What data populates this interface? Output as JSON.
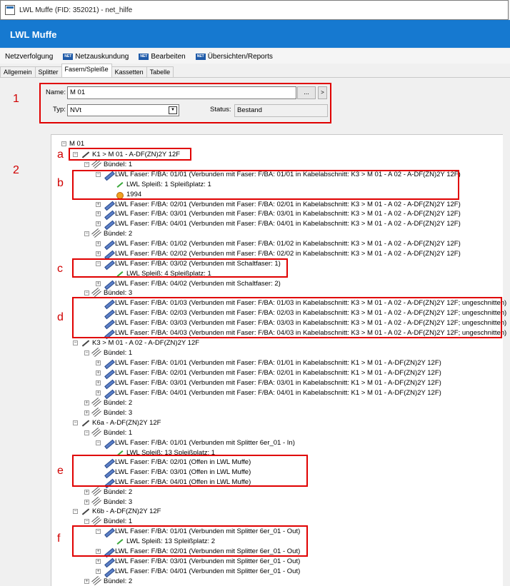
{
  "window": {
    "title": "LWL Muffe (FID: 352021) - net_hilfe"
  },
  "banner": {
    "title": "LWL Muffe"
  },
  "menu": [
    {
      "label": "Netzverfolgung",
      "icon": ""
    },
    {
      "label": "Netzauskundung",
      "icon": "NET"
    },
    {
      "label": "Bearbeiten",
      "icon": "NET"
    },
    {
      "label": "Übersichten/Reports",
      "icon": "NET"
    }
  ],
  "tabs": [
    "Allgemein",
    "Splitter",
    "Fasern/Spleiße",
    "Kassetten",
    "Tabelle"
  ],
  "form": {
    "name_label": "Name:",
    "name_value": "M 01",
    "dots_label": "...",
    "arrow_label": ">",
    "typ_label": "Typ:",
    "typ_value": "NVt",
    "status_label": "Status:",
    "status_value": "Bestand"
  },
  "markers": {
    "m1": "1",
    "m2": "2",
    "a": "a",
    "b": "b",
    "c": "c",
    "d": "d",
    "e": "e",
    "f": "f"
  },
  "tree": [
    {
      "t": "M 01",
      "icon": ""
    },
    {
      "t": "K1 > M 01 - A-DF(ZN)2Y 12F",
      "icon": "cable"
    },
    {
      "t": "Bündel: 1",
      "icon": "bundle"
    },
    {
      "t": "LWL Faser: F/BA: 01/01 (Verbunden mit Faser: F/BA: 01/01 in Kabelabschnitt: K3 > M 01 - A 02 - A-DF(ZN)2Y 12F)",
      "icon": "fiber"
    },
    {
      "t": "LWL Spleiß: 1 Spleißplatz: 1",
      "icon": "splice"
    },
    {
      "t": "1994",
      "icon": "sun"
    },
    {
      "t": "LWL Faser: F/BA: 02/01 (Verbunden mit Faser: F/BA: 02/01 in Kabelabschnitt: K3 > M 01 - A 02 - A-DF(ZN)2Y 12F)",
      "icon": "fiber"
    },
    {
      "t": "LWL Faser: F/BA: 03/01 (Verbunden mit Faser: F/BA: 03/01 in Kabelabschnitt: K3 > M 01 - A 02 - A-DF(ZN)2Y 12F)",
      "icon": "fiber"
    },
    {
      "t": "LWL Faser: F/BA: 04/01 (Verbunden mit Faser: F/BA: 04/01 in Kabelabschnitt: K3 > M 01 - A 02 - A-DF(ZN)2Y 12F)",
      "icon": "fiber"
    },
    {
      "t": "Bündel: 2",
      "icon": "bundle"
    },
    {
      "t": "LWL Faser: F/BA: 01/02 (Verbunden mit Faser: F/BA: 01/02 in Kabelabschnitt: K3 > M 01 - A 02 - A-DF(ZN)2Y 12F)",
      "icon": "fiber"
    },
    {
      "t": "LWL Faser: F/BA: 02/02 (Verbunden mit Faser: F/BA: 02/02 in Kabelabschnitt: K3 > M 01 - A 02 - A-DF(ZN)2Y 12F)",
      "icon": "fiber"
    },
    {
      "t": "LWL Faser: F/BA: 03/02 (Verbunden mit Schaltfaser: 1)",
      "icon": "fiber"
    },
    {
      "t": "LWL Spleiß: 4 Spleißplatz: 1",
      "icon": "splice"
    },
    {
      "t": "LWL Faser: F/BA: 04/02 (Verbunden mit Schaltfaser: 2)",
      "icon": "fiber"
    },
    {
      "t": "Bündel: 3",
      "icon": "bundle"
    },
    {
      "t": "LWL Faser: F/BA: 01/03 (Verbunden mit Faser: F/BA: 01/03 in Kabelabschnitt: K3 > M 01 - A 02 - A-DF(ZN)2Y 12F; ungeschnitten)",
      "icon": "fiber"
    },
    {
      "t": "LWL Faser: F/BA: 02/03 (Verbunden mit Faser: F/BA: 02/03 in Kabelabschnitt: K3 > M 01 - A 02 - A-DF(ZN)2Y 12F; ungeschnitten)",
      "icon": "fiber"
    },
    {
      "t": "LWL Faser: F/BA: 03/03 (Verbunden mit Faser: F/BA: 03/03 in Kabelabschnitt: K3 > M 01 - A 02 - A-DF(ZN)2Y 12F; ungeschnitten)",
      "icon": "fiber"
    },
    {
      "t": "LWL Faser: F/BA: 04/03 (Verbunden mit Faser: F/BA: 04/03 in Kabelabschnitt: K3 > M 01 - A 02 - A-DF(ZN)2Y 12F; ungeschnitten)",
      "icon": "fiber"
    },
    {
      "t": "K3 > M 01 - A 02 - A-DF(ZN)2Y 12F",
      "icon": "cable"
    },
    {
      "t": "Bündel: 1",
      "icon": "bundle"
    },
    {
      "t": "LWL Faser: F/BA: 01/01 (Verbunden mit Faser: F/BA: 01/01 in Kabelabschnitt: K1 > M 01 - A-DF(ZN)2Y 12F)",
      "icon": "fiber"
    },
    {
      "t": "LWL Faser: F/BA: 02/01 (Verbunden mit Faser: F/BA: 02/01 in Kabelabschnitt: K1 > M 01 - A-DF(ZN)2Y 12F)",
      "icon": "fiber"
    },
    {
      "t": "LWL Faser: F/BA: 03/01 (Verbunden mit Faser: F/BA: 03/01 in Kabelabschnitt: K1 > M 01 - A-DF(ZN)2Y 12F)",
      "icon": "fiber"
    },
    {
      "t": "LWL Faser: F/BA: 04/01 (Verbunden mit Faser: F/BA: 04/01 in Kabelabschnitt: K1 > M 01 - A-DF(ZN)2Y 12F)",
      "icon": "fiber"
    },
    {
      "t": "Bündel: 2",
      "icon": "bundle"
    },
    {
      "t": "Bündel: 3",
      "icon": "bundle"
    },
    {
      "t": "K6a - A-DF(ZN)2Y 12F",
      "icon": "cable"
    },
    {
      "t": "Bündel: 1",
      "icon": "bundle"
    },
    {
      "t": "LWL Faser: F/BA: 01/01 (Verbunden mit Splitter 6er_01 - In)",
      "icon": "fiber"
    },
    {
      "t": "LWL Spleiß: 13 Spleißplatz: 1",
      "icon": "splice"
    },
    {
      "t": "LWL Faser: F/BA: 02/01 (Offen in LWL Muffe)",
      "icon": "fiber"
    },
    {
      "t": "LWL Faser: F/BA: 03/01 (Offen in LWL Muffe)",
      "icon": "fiber"
    },
    {
      "t": "LWL Faser: F/BA: 04/01 (Offen in LWL Muffe)",
      "icon": "fiber"
    },
    {
      "t": "Bündel: 2",
      "icon": "bundle"
    },
    {
      "t": "Bündel: 3",
      "icon": "bundle"
    },
    {
      "t": "K6b - A-DF(ZN)2Y 12F",
      "icon": "cable"
    },
    {
      "t": "Bündel: 1",
      "icon": "bundle"
    },
    {
      "t": "LWL Faser: F/BA: 01/01 (Verbunden mit Splitter 6er_01 - Out)",
      "icon": "fiber"
    },
    {
      "t": "LWL Spleiß: 13 Spleißplatz: 2",
      "icon": "splice"
    },
    {
      "t": "LWL Faser: F/BA: 02/01 (Verbunden mit Splitter 6er_01 - Out)",
      "icon": "fiber"
    },
    {
      "t": "LWL Faser: F/BA: 03/01 (Verbunden mit Splitter 6er_01 - Out)",
      "icon": "fiber"
    },
    {
      "t": "LWL Faser: F/BA: 04/01 (Verbunden mit Splitter 6er_01 - Out)",
      "icon": "fiber"
    },
    {
      "t": "Bündel: 2",
      "icon": "bundle"
    }
  ]
}
